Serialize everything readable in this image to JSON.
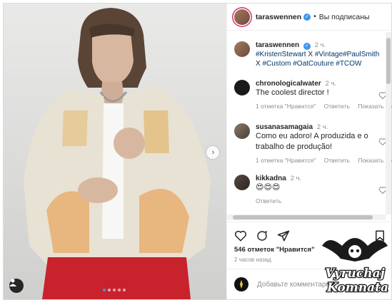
{
  "post": {
    "username": "taraswennen",
    "status": "Вы подписаны",
    "separator": "•",
    "caption_time": "2 ч.",
    "caption_line1_tags": [
      "#KristenStewart",
      "X",
      "#Vintage",
      "#PaulSmith"
    ],
    "caption_line2_tags": [
      "X",
      "#Custom",
      "#OatCouture",
      "#TCOW"
    ],
    "carousel_dots": 5,
    "carousel_active": 0
  },
  "comments": [
    {
      "user": "chronologicalwater",
      "time": "2 ч.",
      "text": "The coolest director !",
      "likes": "1 отметка \"Нравится\"",
      "reply": "Ответить",
      "show": "Показать пе"
    },
    {
      "user": "susanasamagaia",
      "time": "2 ч.",
      "text": "Como eu adoro! A produzida e o trabalho de produção!",
      "likes": "1 отметка \"Нравится\"",
      "reply": "Ответить",
      "show": "Показать пе"
    },
    {
      "user": "kikkadna",
      "time": "2 ч.",
      "text": "😍😍😍",
      "reply": "Ответить"
    }
  ],
  "footer": {
    "likes": "546 отметок \"Нравится\"",
    "ago": "2 часов назад",
    "add_comment_placeholder": "Добавьте комментарий..."
  },
  "icons": [
    "heart-icon",
    "comment-icon",
    "share-icon",
    "bookmark-icon",
    "verified-icon",
    "chevron-right-icon",
    "user-tag-icon",
    "emoji-icon"
  ],
  "colors": {
    "accent": "#3897f0",
    "hashtag": "#00376b",
    "muted": "#8e8e8e",
    "text": "#262626"
  },
  "watermark": {
    "line1": "Vyruchaj",
    "line2": "Komnata"
  }
}
